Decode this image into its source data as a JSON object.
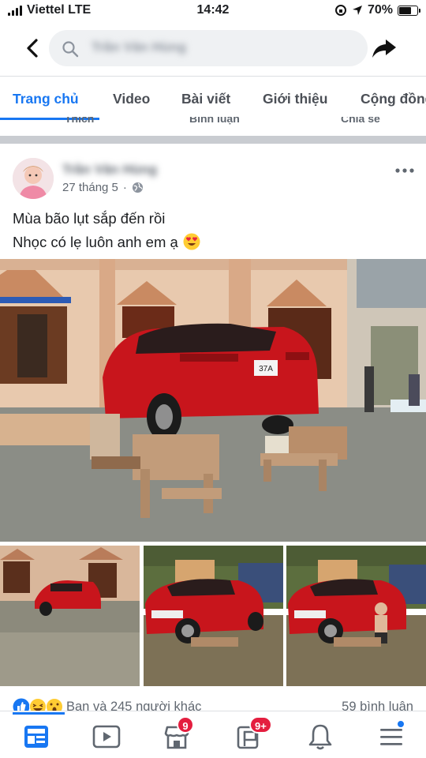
{
  "status_bar": {
    "carrier": "Viettel LTE",
    "time": "14:42",
    "battery": "70%",
    "battery_level": 0.7
  },
  "top_nav": {
    "search_text": "Trần Văn Hùng"
  },
  "tabs": [
    {
      "label": "Trang chủ",
      "active": true
    },
    {
      "label": "Video",
      "active": false
    },
    {
      "label": "Bài viết",
      "active": false
    },
    {
      "label": "Giới thiệu",
      "active": false
    },
    {
      "label": "Cộng đồng",
      "active": false
    }
  ],
  "peek_row": [
    "Thích",
    "Bình luận",
    "Chia sẻ"
  ],
  "post": {
    "author": "Trần Văn Hùng",
    "date": "27 tháng 5",
    "separator": "·",
    "text_line1": "Mùa bão lụt sắp đến rồi",
    "text_line2": "Nhọc có lẹ luôn anh em ạ",
    "plate_text": "37A"
  },
  "reactions": {
    "summary": "Bạn và 245 người khác",
    "comments": "59 bình luận"
  },
  "bottom_nav": {
    "marketplace_badge": "9",
    "pages_badge": "9+"
  },
  "colors": {
    "accent": "#1877f2",
    "badge": "#e41e3f",
    "car_red": "#c8151c"
  }
}
